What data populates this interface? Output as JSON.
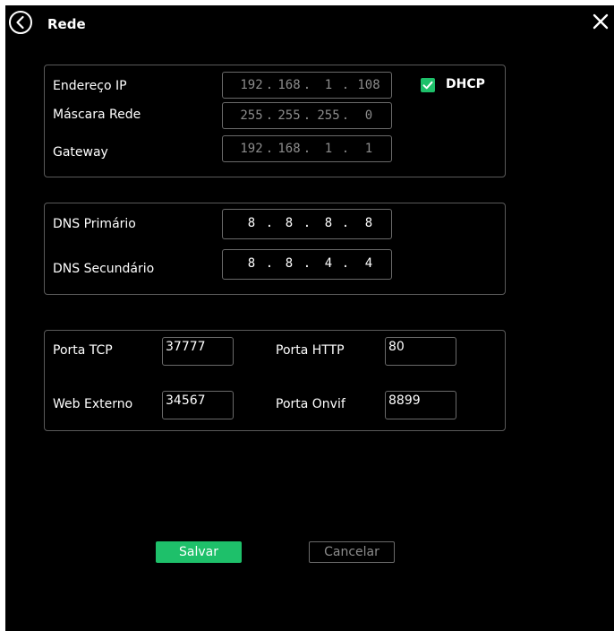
{
  "header": {
    "title": "Rede",
    "back_icon": "back-circle-icon",
    "close_icon": "close-icon"
  },
  "ip_section": {
    "ip_label": "Endereço IP",
    "ip_value": [
      "192",
      ".",
      "168",
      ".",
      "1",
      ".",
      "108"
    ],
    "mask_label": "Máscara Rede",
    "mask_value": [
      "255",
      ".",
      "255",
      ".",
      "255",
      ".",
      "0"
    ],
    "gateway_label": "Gateway",
    "gateway_value": [
      "192",
      ".",
      "168",
      ".",
      "1",
      ".",
      "1"
    ],
    "dhcp_label": "DHCP",
    "dhcp_checked": true
  },
  "dns_section": {
    "primary_label": "DNS Primário",
    "primary_value": [
      "8",
      ".",
      "8",
      ".",
      "8",
      ".",
      "8"
    ],
    "secondary_label": "DNS Secundário",
    "secondary_value": [
      "8",
      ".",
      "8",
      ".",
      "4",
      ".",
      "4"
    ]
  },
  "ports_section": {
    "tcp_label": "Porta TCP",
    "tcp_value": "37777",
    "http_label": "Porta HTTP",
    "http_value": "80",
    "web_label": "Web Externo",
    "web_value": "34567",
    "onvif_label": "Porta Onvif",
    "onvif_value": "8899"
  },
  "actions": {
    "save_label": "Salvar",
    "cancel_label": "Cancelar"
  },
  "colors": {
    "accent": "#1ec06a",
    "background": "#000000",
    "border": "#5a5a5a"
  }
}
